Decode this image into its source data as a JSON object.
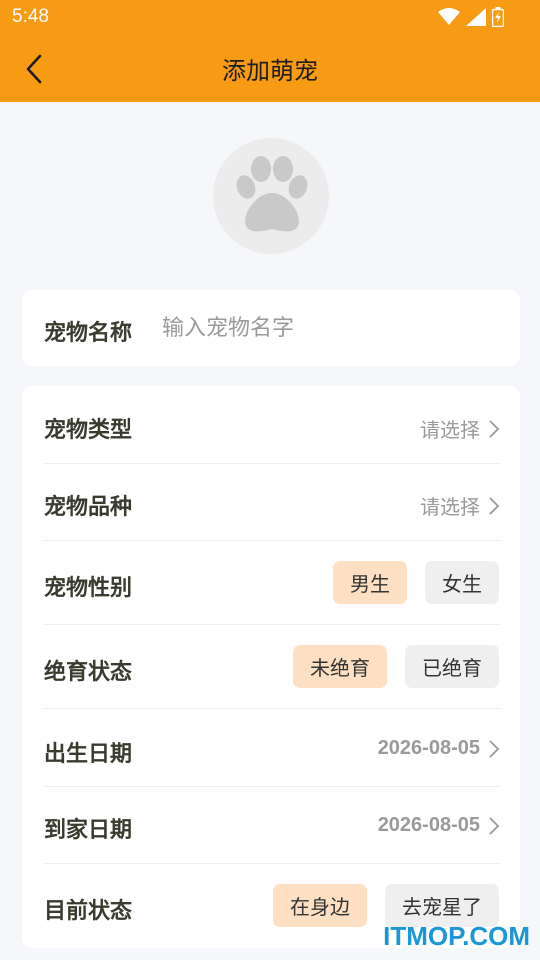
{
  "status_bar": {
    "time": "5:48"
  },
  "header": {
    "title": "添加萌宠"
  },
  "colors": {
    "header": "#f89b14",
    "chip_selected": "#fde0c3",
    "chip_default": "#efefef",
    "watermark": "#1a97d6"
  },
  "name_field": {
    "label": "宠物名称",
    "placeholder": "输入宠物名字",
    "value": ""
  },
  "form": {
    "type": {
      "label": "宠物类型",
      "value": "请选择"
    },
    "breed": {
      "label": "宠物品种",
      "value": "请选择"
    },
    "gender": {
      "label": "宠物性别",
      "options": [
        "男生",
        "女生"
      ],
      "selected": "男生"
    },
    "neuter": {
      "label": "绝育状态",
      "options": [
        "未绝育",
        "已绝育"
      ],
      "selected": "未绝育"
    },
    "birth_date": {
      "label": "出生日期",
      "value": "2026-08-05"
    },
    "home_date": {
      "label": "到家日期",
      "value": "2026-08-05"
    },
    "status": {
      "label": "目前状态",
      "options": [
        "在身边",
        "去宠星了"
      ],
      "selected": "在身边"
    }
  },
  "watermark": "ITMOP.COM"
}
